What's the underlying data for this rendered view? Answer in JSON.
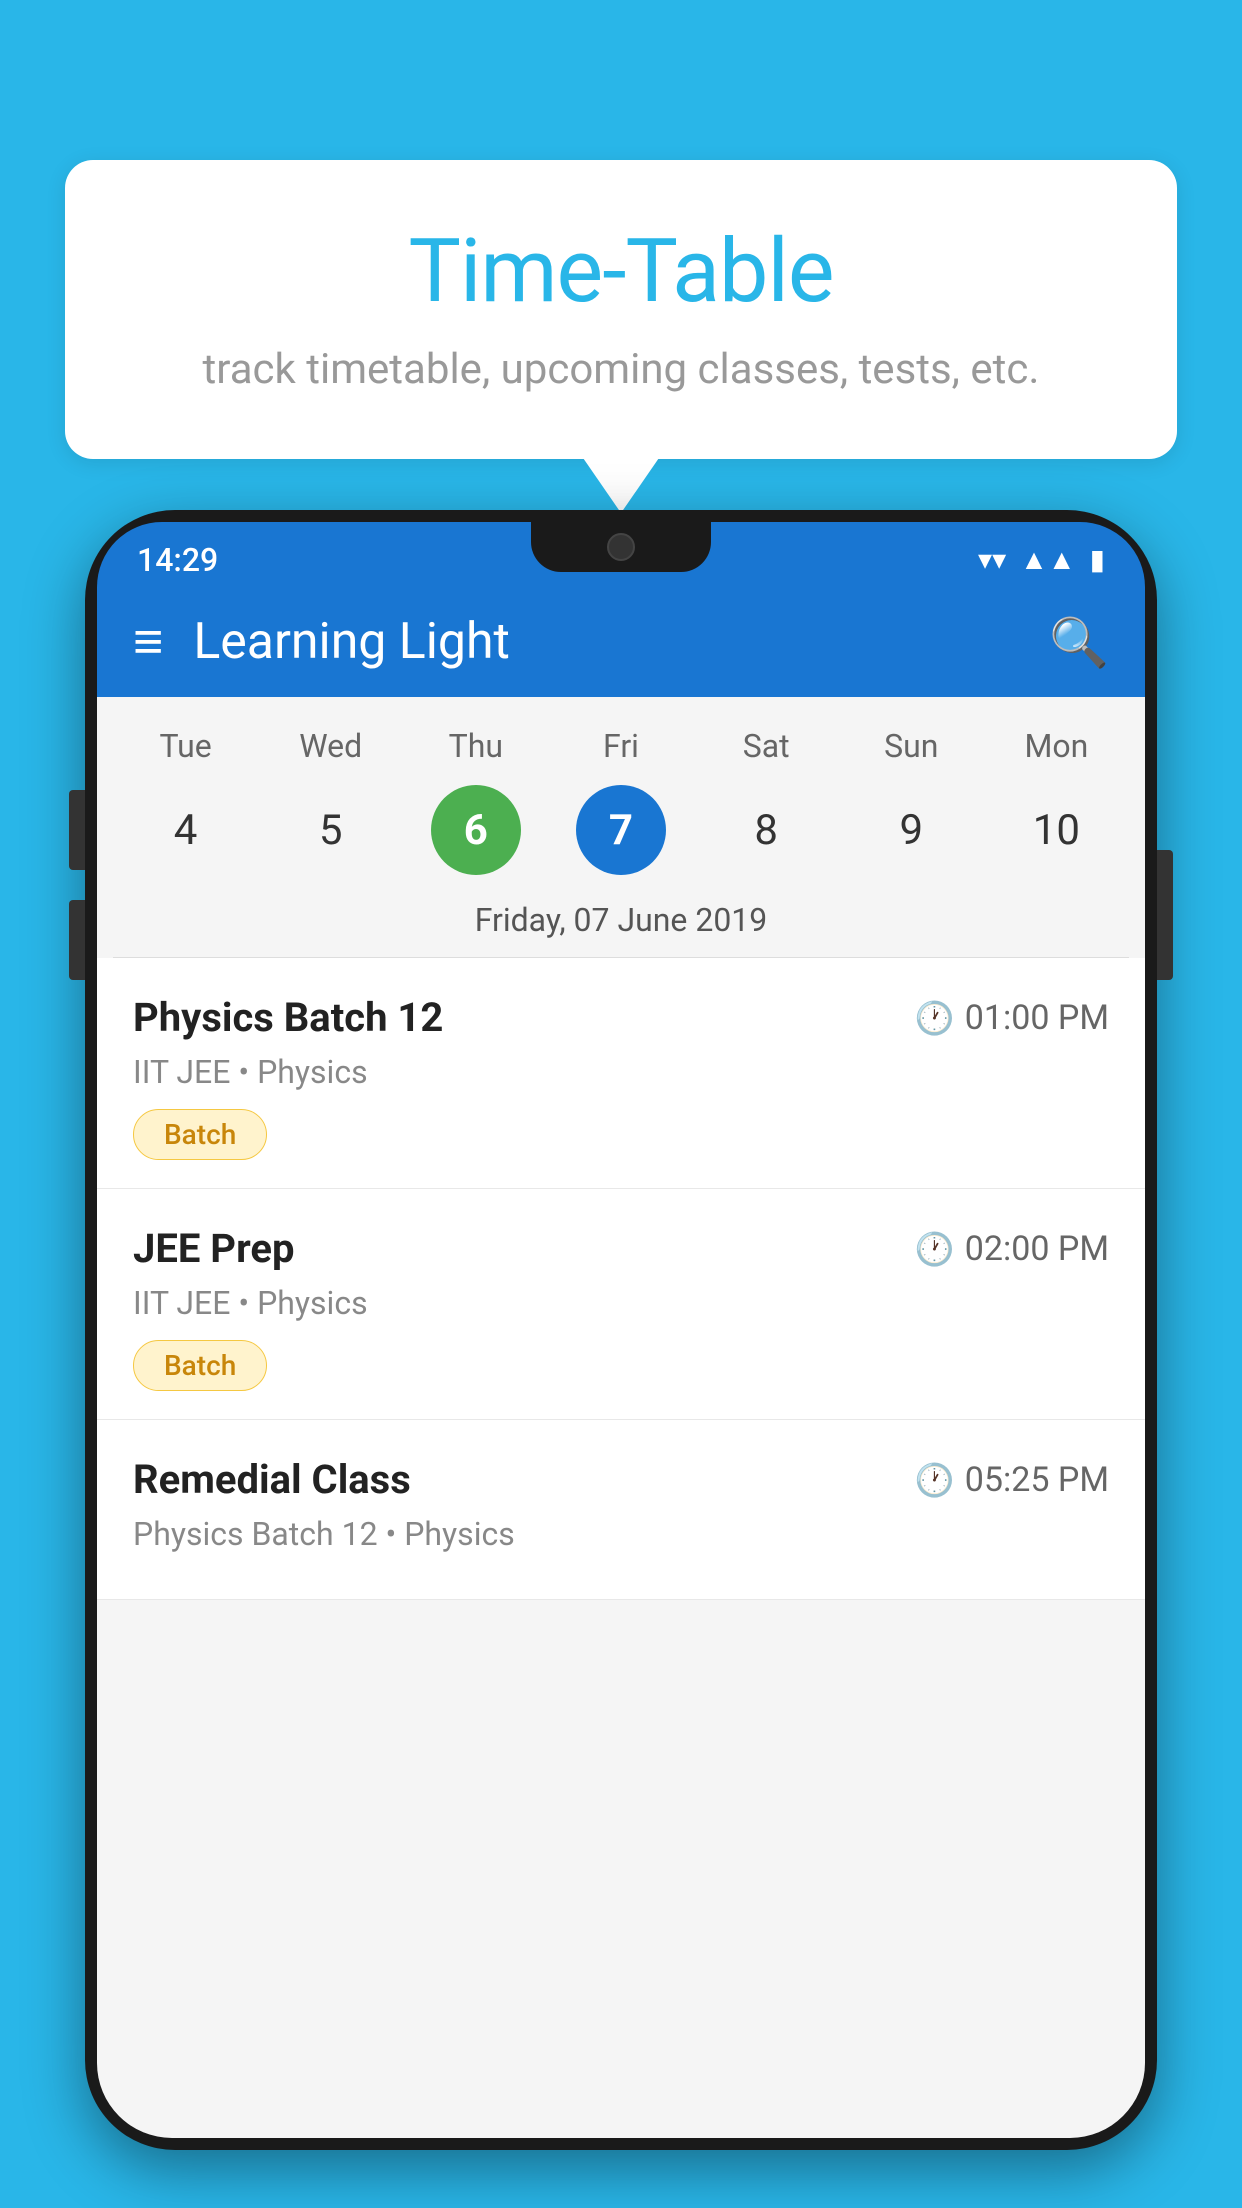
{
  "background": {
    "color": "#29B6E8"
  },
  "speechBubble": {
    "title": "Time-Table",
    "subtitle": "track timetable, upcoming classes, tests, etc."
  },
  "phone": {
    "statusBar": {
      "time": "14:29"
    },
    "appBar": {
      "title": "Learning Light",
      "menuIcon": "≡",
      "searchIcon": "🔍"
    },
    "calendar": {
      "days": [
        "Tue",
        "Wed",
        "Thu",
        "Fri",
        "Sat",
        "Sun",
        "Mon"
      ],
      "dates": [
        "4",
        "5",
        "6",
        "7",
        "8",
        "9",
        "10"
      ],
      "todayIndex": 2,
      "selectedIndex": 3,
      "selectedDateLabel": "Friday, 07 June 2019"
    },
    "schedule": [
      {
        "title": "Physics Batch 12",
        "time": "01:00 PM",
        "subtitle": "IIT JEE • Physics",
        "tag": "Batch"
      },
      {
        "title": "JEE Prep",
        "time": "02:00 PM",
        "subtitle": "IIT JEE • Physics",
        "tag": "Batch"
      },
      {
        "title": "Remedial Class",
        "time": "05:25 PM",
        "subtitle": "Physics Batch 12 • Physics",
        "tag": ""
      }
    ]
  }
}
